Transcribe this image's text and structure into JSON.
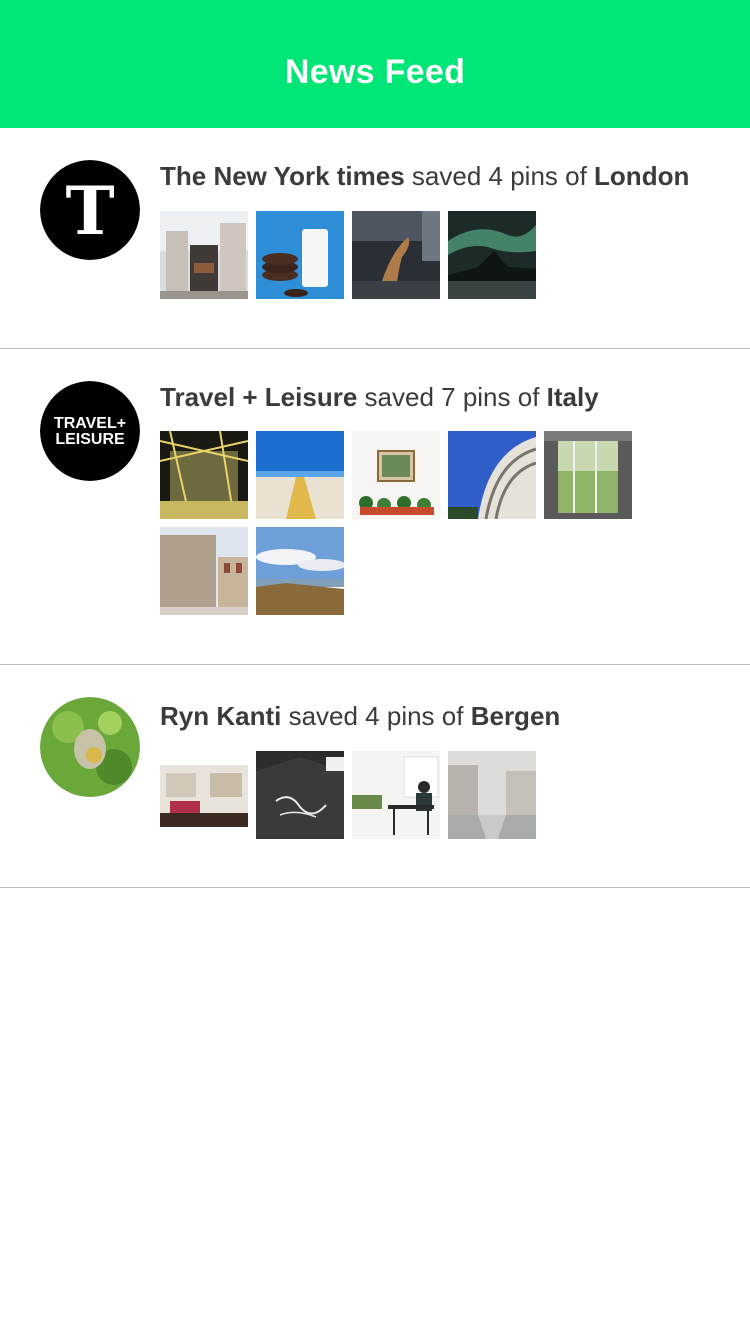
{
  "header": {
    "title": "News Feed"
  },
  "feed": [
    {
      "author": "The New York times",
      "action": "saved 4 pins of",
      "board": "London",
      "avatar": "nyt-logo-icon",
      "pins": [
        "street-corner-photo",
        "milk-and-cookies-photo",
        "dancer-street-photo",
        "aurora-mountain-photo"
      ]
    },
    {
      "author": "Travel + Leisure",
      "action": "saved 7 pins of",
      "board": "Italy",
      "avatar": "travel-leisure-logo-icon",
      "avatar_text_1": "TRAVEL+",
      "avatar_text_2": "LEISURE",
      "pins": [
        "golden-hall-photo",
        "beach-boardwalk-photo",
        "window-plants-photo",
        "curved-building-photo",
        "window-forest-photo",
        "stone-building-photo",
        "coastal-cliffs-photo"
      ]
    },
    {
      "author": "Ryn Kanti",
      "action": "saved 4 pins of",
      "board": "Bergen",
      "avatar": "leaf-stone-avatar-icon",
      "pins": [
        "store-interior-photo",
        "brick-wall-lettering-photo",
        "cafe-interior-photo",
        "foggy-canal-photo"
      ]
    }
  ]
}
